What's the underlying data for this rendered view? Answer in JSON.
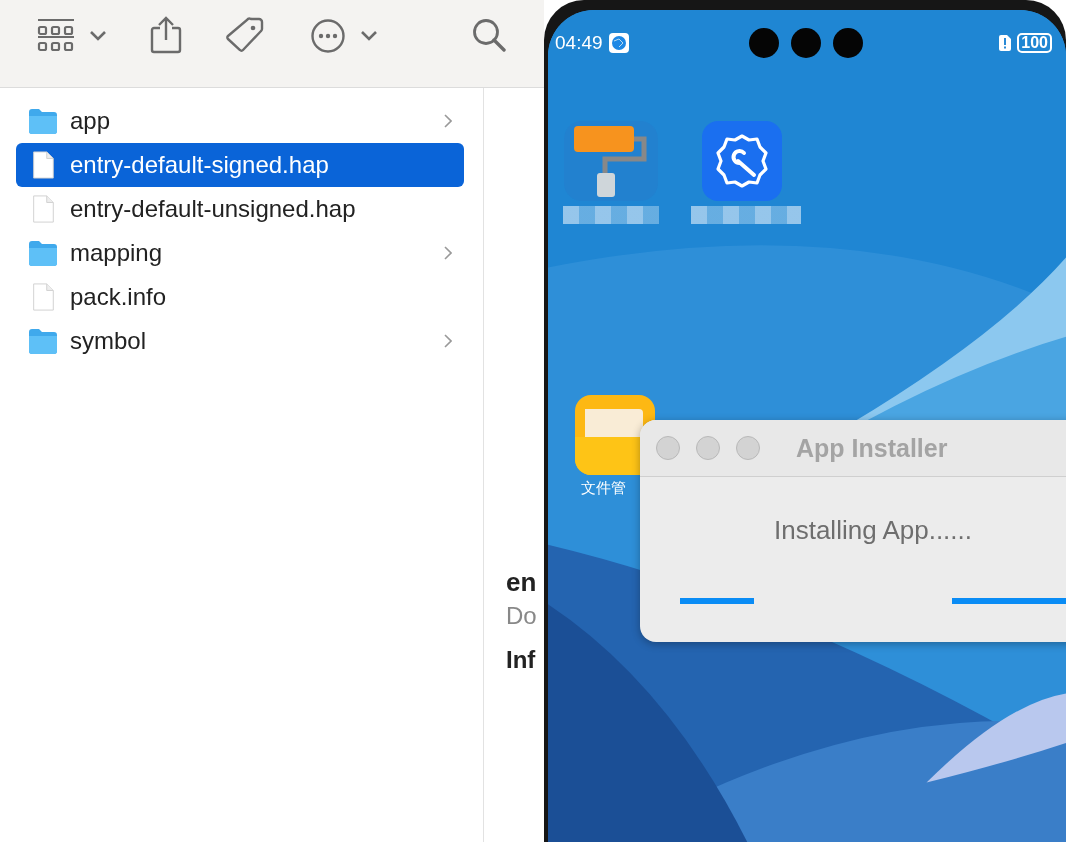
{
  "finder": {
    "files": [
      {
        "name": "app",
        "kind": "folder",
        "selected": false
      },
      {
        "name": "entry-default-signed.hap",
        "kind": "file",
        "selected": true
      },
      {
        "name": "entry-default-unsigned.hap",
        "kind": "file",
        "selected": false
      },
      {
        "name": "mapping",
        "kind": "folder",
        "selected": false
      },
      {
        "name": "pack.info",
        "kind": "file",
        "selected": false
      },
      {
        "name": "symbol",
        "kind": "folder",
        "selected": false
      }
    ],
    "preview": {
      "title": "en",
      "kind_text": "Do",
      "section": "Inf"
    }
  },
  "phone": {
    "status_bar": {
      "time": "04:49",
      "battery": "100"
    },
    "apps": [
      {
        "kind": "roller"
      },
      {
        "kind": "settings"
      },
      {
        "kind": "folder",
        "label": "文件管"
      }
    ]
  },
  "dialog": {
    "title": "App Installer",
    "message": "Installing App......"
  }
}
